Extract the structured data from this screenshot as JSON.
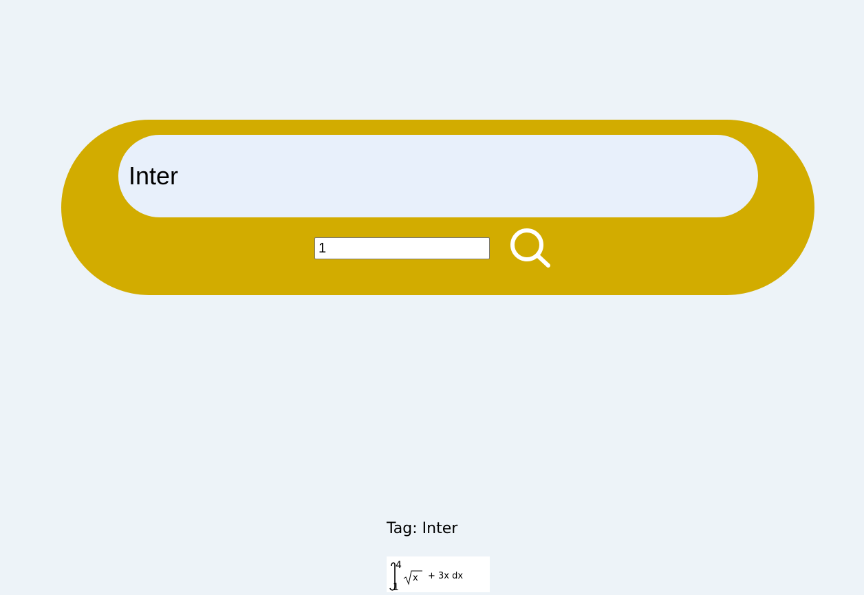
{
  "search": {
    "query_value": "Inter",
    "number_value": "1",
    "button_icon": "search-icon"
  },
  "result": {
    "tag_prefix": "Tag:",
    "tag_value": "Inter",
    "formula": {
      "upper_limit": "4",
      "lower_limit": "1",
      "radicand": "x",
      "rest": "+ 3x dx"
    }
  },
  "colors": {
    "page_background": "#edf3f8",
    "panel": "#d2ac00",
    "query_field": "#e8f0fb",
    "icon": "#ffffff"
  }
}
